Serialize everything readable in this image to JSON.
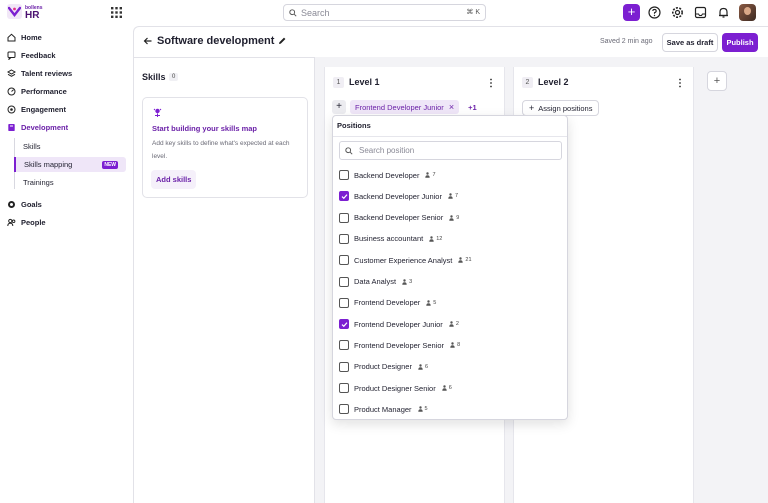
{
  "app": {
    "logo_small": "bollens",
    "logo_big": "HR"
  },
  "search": {
    "placeholder": "Search",
    "shortcut": "⌘ K"
  },
  "sidebar": {
    "items": [
      {
        "label": "Home",
        "icon": "home-icon"
      },
      {
        "label": "Feedback",
        "icon": "chat-icon"
      },
      {
        "label": "Talent reviews",
        "icon": "layers-icon"
      },
      {
        "label": "Performance",
        "icon": "gauge-icon"
      },
      {
        "label": "Engagement",
        "icon": "target-icon"
      },
      {
        "label": "Development",
        "icon": "book-icon"
      }
    ],
    "sub_items": [
      {
        "label": "Skills"
      },
      {
        "label": "Skills mapping",
        "badge": "NEW"
      },
      {
        "label": "Trainings"
      }
    ],
    "bottom_items": [
      {
        "label": "Goals",
        "icon": "goal-icon"
      },
      {
        "label": "People",
        "icon": "people-icon"
      }
    ]
  },
  "header": {
    "title": "Software development",
    "saved": "Saved 2 min ago",
    "draft_label": "Save as draft",
    "publish_label": "Publish"
  },
  "skills": {
    "title": "Skills",
    "count": "0",
    "card_title": "Start building your skills map",
    "card_text": "Add key skills to define what's expected at each level.",
    "add_label": "Add skills"
  },
  "levels": [
    {
      "number": "1",
      "name": "Level 1",
      "chip": "Frontend Developer Junior",
      "more": "+1"
    },
    {
      "number": "2",
      "name": "Level 2",
      "assign_label": "Assign positions"
    }
  ],
  "add_level_symbol": "+",
  "dropdown": {
    "title": "Positions",
    "search_placeholder": "Search position",
    "items": [
      {
        "label": "Backend Developer",
        "count": "7",
        "checked": false
      },
      {
        "label": "Backend Developer Junior",
        "count": "7",
        "checked": true
      },
      {
        "label": "Backend Developer Senior",
        "count": "9",
        "checked": false
      },
      {
        "label": "Business accountant",
        "count": "12",
        "checked": false
      },
      {
        "label": "Customer Experience Analyst",
        "count": "21",
        "checked": false
      },
      {
        "label": "Data Analyst",
        "count": "3",
        "checked": false
      },
      {
        "label": "Frontend Developer",
        "count": "5",
        "checked": false
      },
      {
        "label": "Frontend Developer Junior",
        "count": "2",
        "checked": true
      },
      {
        "label": "Frontend Developer Senior",
        "count": "8",
        "checked": false
      },
      {
        "label": "Product Designer",
        "count": "6",
        "checked": false
      },
      {
        "label": "Product Designer Senior",
        "count": "6",
        "checked": false
      },
      {
        "label": "Product Manager",
        "count": "5",
        "checked": false
      }
    ]
  },
  "colors": {
    "accent": "#7c1fd1",
    "accent_light": "#efe6f8",
    "border": "#e2e2e8"
  }
}
